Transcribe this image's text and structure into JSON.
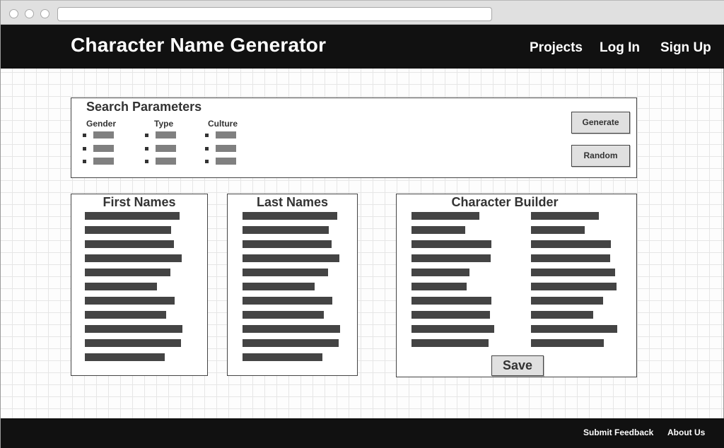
{
  "header": {
    "title": "Character Name Generator",
    "nav": [
      "Projects",
      "Log In",
      "Sign Up"
    ]
  },
  "search": {
    "title": "Search Parameters",
    "columns": [
      {
        "label": "Gender",
        "options": 3
      },
      {
        "label": "Type",
        "options": 3
      },
      {
        "label": "Culture",
        "options": 3
      }
    ],
    "generate_label": "Generate",
    "random_label": "Random"
  },
  "first_names": {
    "title": "First Names",
    "count": 11
  },
  "last_names": {
    "title": "Last Names",
    "count": 11
  },
  "builder": {
    "title": "Character Builder",
    "save_label": "Save"
  },
  "footer": {
    "links": [
      "Submit Feedback",
      "About Us"
    ]
  }
}
